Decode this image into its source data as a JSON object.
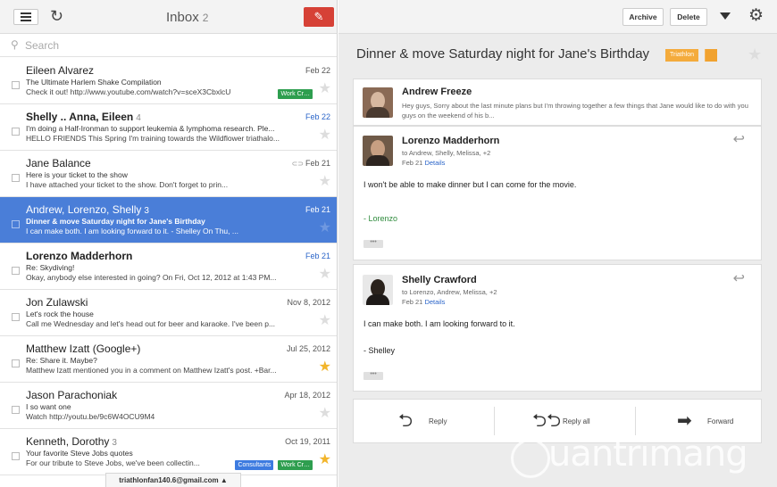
{
  "left_pane": {
    "header": {
      "title": "Inbox",
      "count": "2"
    },
    "search": {
      "placeholder": "Search"
    },
    "account": "triathlonfan140.6@gmail.com ▲",
    "messages": [
      {
        "sender": "Eileen Alvarez",
        "count": "",
        "date": "Feb 22",
        "subject": "The Ultimate Harlem Shake Compilation",
        "snippet": "Check it out! http://www.youtube.com/watch?v=sceX3CbxlcU",
        "unread": false,
        "starred": false,
        "labels": [
          {
            "text": "Work Cr…",
            "color": "#2e9e4f"
          }
        ],
        "attachment": ""
      },
      {
        "sender": "Shelly .. Anna, Eileen",
        "count": "4",
        "date": "Feb 22",
        "subject": "I'm doing a Half-Ironman to support leukemia & lymphoma research. Ple...",
        "snippet": "HELLO FRIENDS This Spring I'm training towards the Wildflower triathalo...",
        "unread": true,
        "starred": false,
        "labels": [],
        "attachment": ""
      },
      {
        "sender": "Jane Balance",
        "count": "",
        "date": "Feb 21",
        "subject": "Here is your ticket to the show",
        "snippet": "I have attached your ticket to the show. Don't forget to prin...",
        "unread": false,
        "starred": false,
        "labels": [],
        "attachment": "⊂⊃"
      },
      {
        "sender": "Andrew, Lorenzo, Shelly",
        "count": "3",
        "date": "Feb 21",
        "subject": "Dinner & move Saturday night for Jane's Birthday",
        "snippet": "I can make both. I am looking forward to it. - Shelley On Thu, ...",
        "unread": false,
        "starred": false,
        "labels": [],
        "attachment": "",
        "selected": true
      },
      {
        "sender": "Lorenzo Madderhorn",
        "count": "",
        "date": "Feb 21",
        "subject": "Re: Skydiving!",
        "snippet": "Okay, anybody else interested in going? On Fri, Oct 12, 2012 at 1:43 PM...",
        "unread": true,
        "starred": false,
        "labels": [],
        "attachment": ""
      },
      {
        "sender": "Jon Zulawski",
        "count": "",
        "date": "Nov 8, 2012",
        "subject": "Let's rock the house",
        "snippet": "Call me Wednesday and let's head out for beer and karaoke. I've been p...",
        "unread": false,
        "starred": false,
        "labels": [],
        "attachment": ""
      },
      {
        "sender": "Matthew Izatt (Google+)",
        "count": "",
        "date": "Jul 25, 2012",
        "subject": "Re: Share it. Maybe?",
        "snippet": "Matthew Izatt mentioned you in a comment on Matthew Izatt's post. +Bar...",
        "unread": false,
        "starred": true,
        "labels": [],
        "attachment": ""
      },
      {
        "sender": "Jason Parachoniak",
        "count": "",
        "date": "Apr 18, 2012",
        "subject": "I so want one",
        "snippet": "Watch http://youtu.be/9c6W4OCU9M4",
        "unread": false,
        "starred": false,
        "labels": [],
        "attachment": ""
      },
      {
        "sender": "Kenneth, Dorothy",
        "count": "3",
        "date": "Oct 19, 2011",
        "subject": "Your favorite Steve Jobs quotes",
        "snippet": "For our tribute to Steve Jobs, we've been collectin...",
        "unread": false,
        "starred": true,
        "labels": [
          {
            "text": "Consultants",
            "color": "#3d7be0"
          },
          {
            "text": "Work Cr…",
            "color": "#2e9e4f"
          }
        ],
        "attachment": ""
      }
    ]
  },
  "right_pane": {
    "toolbar": {
      "archive": "Archive",
      "delete": "Delete"
    },
    "conversation": {
      "title": "Dinner & move Saturday night for Jane's Birthday",
      "label": "Triathlon",
      "collapsed": {
        "from": "Andrew Freeze",
        "snippet": "Hey guys, Sorry about the last minute plans but I'm throwing together a few things that Jane would like to do with you guys on the weekend of his b..."
      },
      "messages": [
        {
          "from": "Lorenzo Madderhorn",
          "to": "to Andrew, Shelly, Melissa, +2",
          "date": "Feb 21",
          "details": "Details",
          "body": "I won't be able to make dinner but I can come for the movie.",
          "signature": "- Lorenzo",
          "signature_color": "#2e8b3c",
          "ellipsis": "•••"
        },
        {
          "from": "Shelly Crawford",
          "to": "to Lorenzo, Andrew, Melissa, +2",
          "date": "Feb 21",
          "details": "Details",
          "body": "I can make both. I am looking forward to it.",
          "signature": "- Shelley",
          "signature_color": "#222222",
          "ellipsis": "•••"
        }
      ]
    },
    "actions": {
      "reply": "Reply",
      "reply_all": "Reply all",
      "forward": "Forward"
    }
  },
  "watermark": "uantrimang"
}
